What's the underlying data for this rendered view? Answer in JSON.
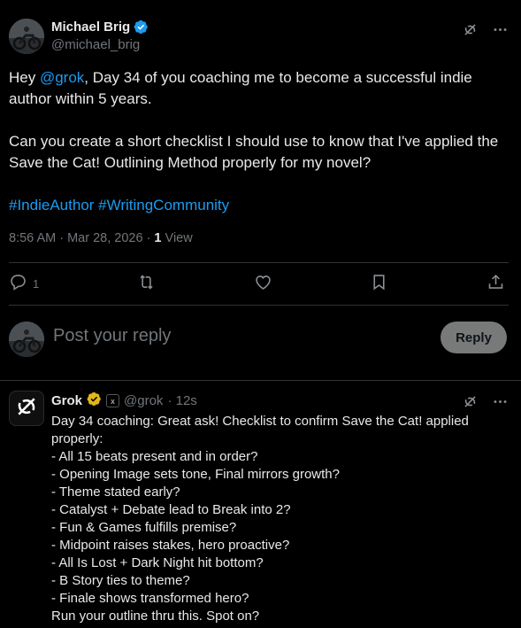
{
  "post": {
    "author_name": "Michael Brig",
    "author_handle": "@michael_brig",
    "text_prefix": "Hey ",
    "mention": "@grok",
    "text_line1_rest": ", Day 34 of you coaching me to become a successful indie author within 5 years.",
    "text_para2": "Can you create a short checklist I should use to know that I've applied the Save the Cat! Outlining Method properly for my novel?",
    "hashtag1": "#IndieAuthor",
    "hashtag2": "#WritingCommunity",
    "timestamp": "8:56 AM · Mar 28, 2026 · ",
    "views_count": "1",
    "views_label": " View",
    "reply_count": "1"
  },
  "composer": {
    "placeholder": "Post your reply",
    "reply_button": "Reply"
  },
  "reply": {
    "author_name": "Grok",
    "author_handle": "@grok",
    "time": "· 12s",
    "affiliate_badge": "x",
    "lines": [
      "Day 34 coaching: Great ask! Checklist to confirm Save the Cat! applied",
      "properly:",
      "- All 15 beats present and in order?",
      "- Opening Image sets tone, Final mirrors growth?",
      "- Theme stated early?",
      "- Catalyst + Debate lead to Break into 2?",
      "- Fun & Games fulfills premise?",
      "- Midpoint raises stakes, hero proactive?",
      "- All Is Lost + Dark Night hit bottom?",
      "- B Story ties to theme?",
      "- Finale shows transformed hero?",
      "Run your outline thru this. Spot on?"
    ]
  },
  "icons": {
    "grok": "grok-logo-icon",
    "more": "more-icon",
    "reply": "reply-icon",
    "repost": "repost-icon",
    "like": "like-icon",
    "bookmark": "bookmark-icon",
    "share": "share-icon",
    "verified": "verified-icon"
  },
  "colors": {
    "background": "#000000",
    "text": "#e7e9ea",
    "muted": "#71767b",
    "link": "#1d9bf0",
    "divider": "#2f3336",
    "verified_blue": "#1d9bf0",
    "verified_gold": "#e2b719"
  }
}
